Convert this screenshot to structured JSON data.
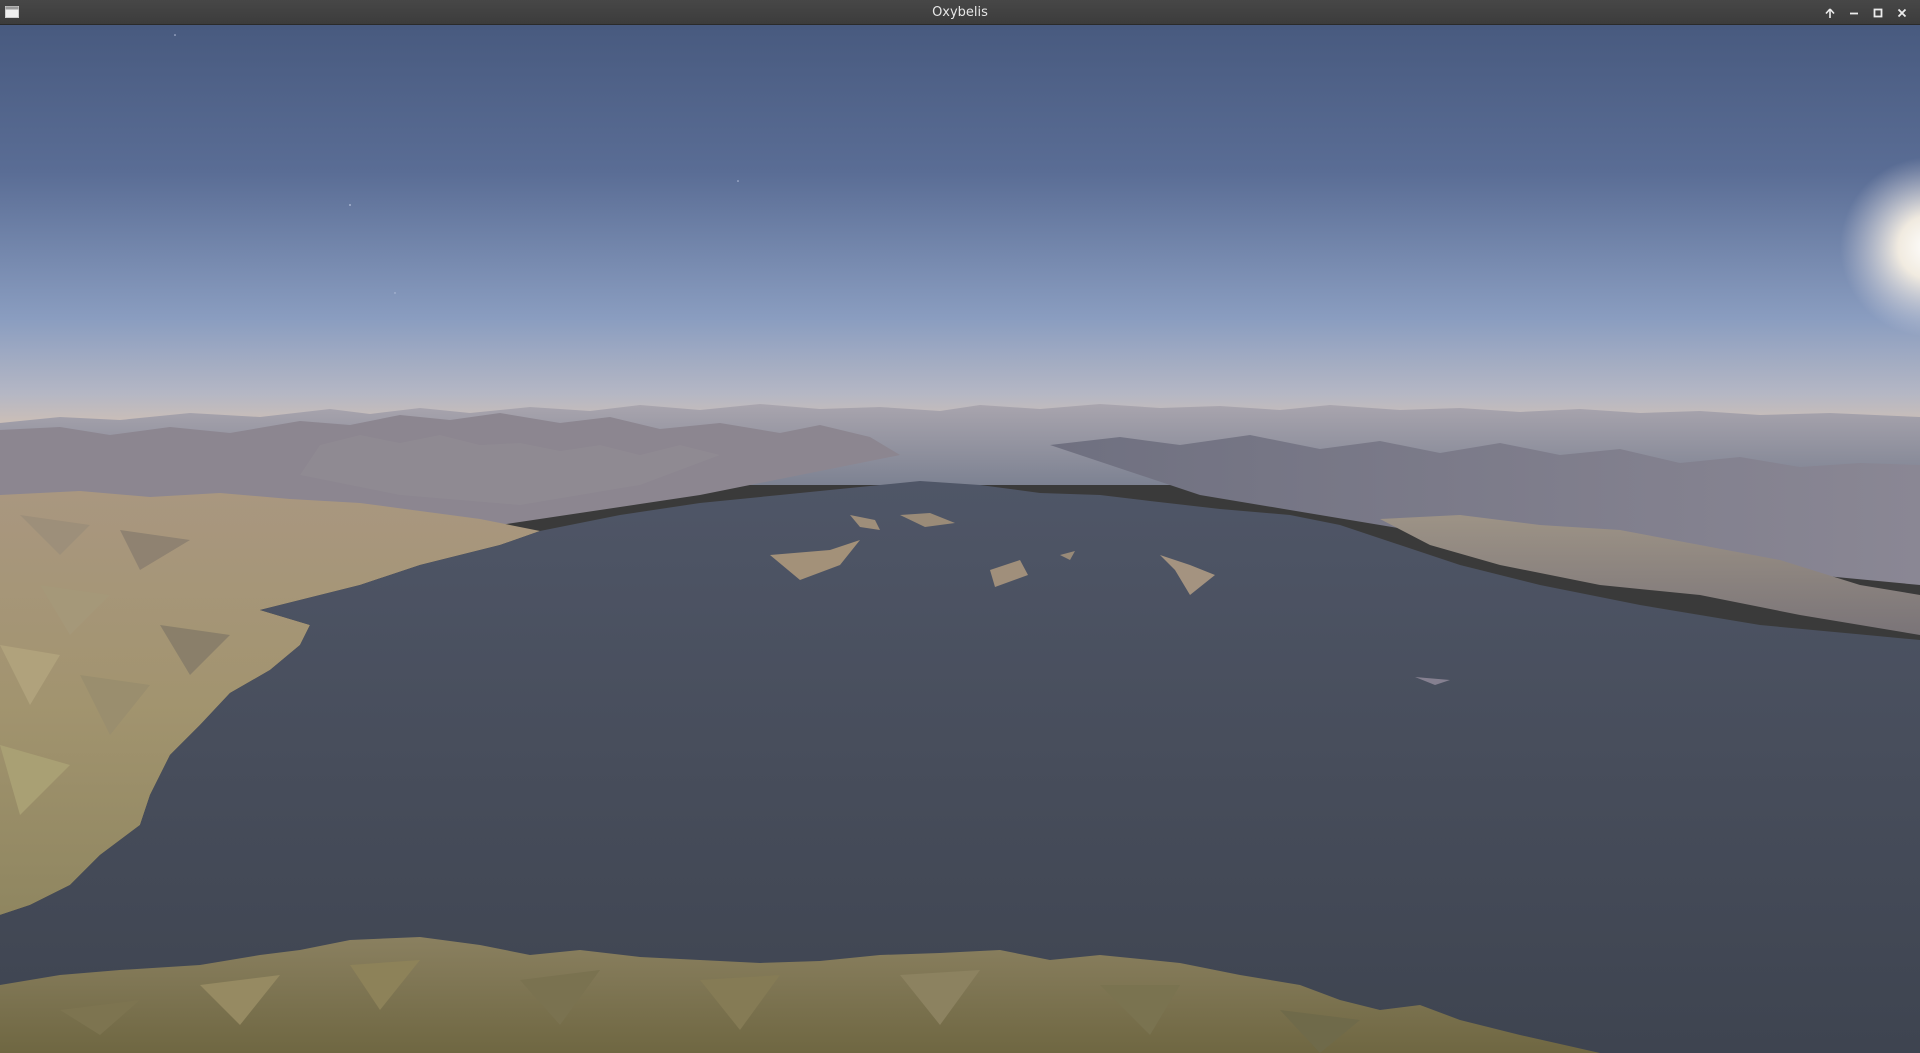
{
  "window": {
    "title": "Oxybelis",
    "icon": "window-menu-icon",
    "controls": [
      {
        "name": "shade-button",
        "icon": "arrow-up-icon"
      },
      {
        "name": "minimize-button",
        "icon": "minimize-icon"
      },
      {
        "name": "maximize-button",
        "icon": "maximize-icon"
      },
      {
        "name": "close-button",
        "icon": "close-icon"
      }
    ]
  },
  "scene": {
    "colors": {
      "sky_top": "#4a5b80",
      "sky_mid": "#7188b0",
      "horizon": "#d7c1ae",
      "shadow_terrain": "#4a5160",
      "lit_terrain": "#a39276",
      "foreground_terrain": "#8a7f55",
      "sun": "#fff8ea"
    }
  }
}
